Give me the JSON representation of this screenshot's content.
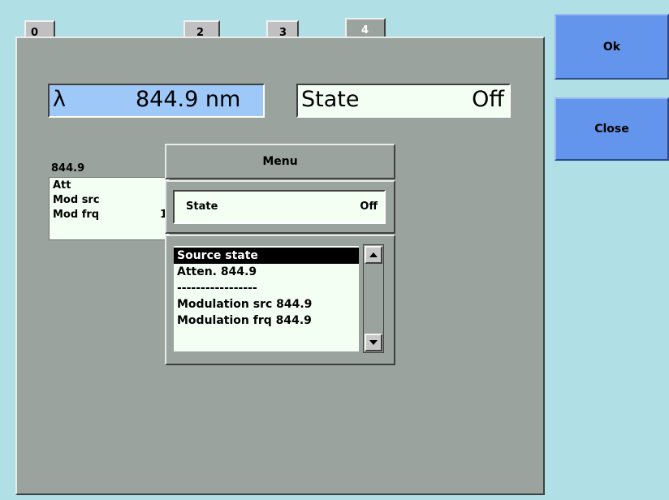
{
  "tabs": [
    "0",
    "2",
    "3",
    "4"
  ],
  "wavelength": {
    "symbol": "λ",
    "value": "844.9 nm"
  },
  "state_box": {
    "label": "State",
    "value": "Off"
  },
  "params": {
    "header": "844.9",
    "rows": [
      {
        "label": "Att",
        "value": ""
      },
      {
        "label": "Mod src",
        "value": ""
      },
      {
        "label": "Mod frq",
        "value": "1"
      }
    ]
  },
  "menu": {
    "title": "Menu",
    "state_label": "State",
    "state_value": "Off",
    "items": [
      "Source state",
      "Atten. 844.9",
      "-----------------",
      "Modulation src 844.9",
      "Modulation frq 844.9"
    ]
  },
  "buttons": {
    "ok": "Ok",
    "close": "Close"
  }
}
